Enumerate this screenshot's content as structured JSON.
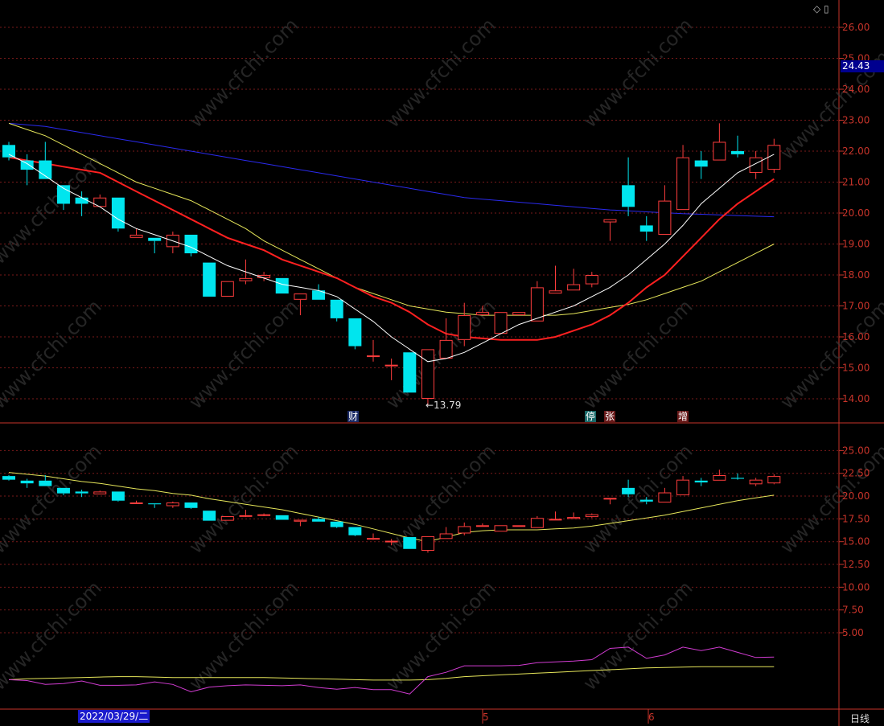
{
  "watermark": "www.cfchi.com",
  "colors": {
    "up": "#ff3d3d",
    "down": "#00e5ee",
    "ma5": "#ffffff",
    "ma10": "#ff2020",
    "ma20": "#e6e65a",
    "ma60": "#2a2aee",
    "osc": "#d23cd2",
    "axis": "#c8342a",
    "grid": "#7a1a1a"
  },
  "corner_icons": "◇ ▯",
  "current_price": "24.43",
  "low_label": "←13.79",
  "event_badges": [
    {
      "text": "财",
      "bg": "#1a2a66",
      "fg": "#ffffff"
    },
    {
      "text": "停",
      "bg": "#1a6a6a",
      "fg": "#ffffff"
    },
    {
      "text": "张",
      "bg": "#6a1a1a",
      "fg": "#ffffff"
    },
    {
      "text": "增",
      "bg": "#6a1a1a",
      "fg": "#ffffff"
    }
  ],
  "x_labels": {
    "date": "2022/03/29/二",
    "month5": "5",
    "month6": "6",
    "period": "日线"
  },
  "chart_data": [
    {
      "type": "candlestick",
      "panel": "main",
      "y_ticks": [
        "26.00",
        "25.00",
        "24.00",
        "23.00",
        "22.00",
        "21.00",
        "20.00",
        "19.00",
        "18.00",
        "17.00",
        "16.00",
        "15.00",
        "14.00"
      ],
      "ylim": [
        13.5,
        26.5
      ],
      "candles": [
        {
          "o": 22.2,
          "h": 22.3,
          "l": 21.7,
          "c": 21.8
        },
        {
          "o": 21.7,
          "h": 21.9,
          "l": 20.9,
          "c": 21.4
        },
        {
          "o": 21.7,
          "h": 22.3,
          "l": 21.1,
          "c": 21.1
        },
        {
          "o": 20.9,
          "h": 20.9,
          "l": 20.1,
          "c": 20.3
        },
        {
          "o": 20.5,
          "h": 20.7,
          "l": 19.9,
          "c": 20.3
        },
        {
          "o": 20.2,
          "h": 20.6,
          "l": 20.2,
          "c": 20.5
        },
        {
          "o": 20.5,
          "h": 20.5,
          "l": 19.4,
          "c": 19.5
        },
        {
          "o": 19.2,
          "h": 19.5,
          "l": 19.2,
          "c": 19.3
        },
        {
          "o": 19.2,
          "h": 19.2,
          "l": 18.7,
          "c": 19.1
        },
        {
          "o": 18.9,
          "h": 19.4,
          "l": 18.7,
          "c": 19.3
        },
        {
          "o": 19.3,
          "h": 19.3,
          "l": 18.6,
          "c": 18.7
        },
        {
          "o": 18.4,
          "h": 18.4,
          "l": 17.3,
          "c": 17.3
        },
        {
          "o": 17.3,
          "h": 17.8,
          "l": 17.3,
          "c": 17.8
        },
        {
          "o": 17.8,
          "h": 18.5,
          "l": 17.7,
          "c": 17.9
        },
        {
          "o": 17.9,
          "h": 18.1,
          "l": 17.8,
          "c": 18.0
        },
        {
          "o": 17.9,
          "h": 17.9,
          "l": 17.4,
          "c": 17.4
        },
        {
          "o": 17.2,
          "h": 17.4,
          "l": 16.7,
          "c": 17.4
        },
        {
          "o": 17.5,
          "h": 17.7,
          "l": 17.2,
          "c": 17.2
        },
        {
          "o": 17.2,
          "h": 17.2,
          "l": 16.5,
          "c": 16.6
        },
        {
          "o": 16.6,
          "h": 16.6,
          "l": 15.6,
          "c": 15.7
        },
        {
          "o": 15.4,
          "h": 15.9,
          "l": 15.2,
          "c": 15.4
        },
        {
          "o": 15.1,
          "h": 15.3,
          "l": 14.6,
          "c": 15.1
        },
        {
          "o": 15.5,
          "h": 15.5,
          "l": 14.2,
          "c": 14.2
        },
        {
          "o": 14.0,
          "h": 15.6,
          "l": 13.79,
          "c": 15.6
        },
        {
          "o": 15.3,
          "h": 16.6,
          "l": 15.3,
          "c": 15.9
        },
        {
          "o": 15.9,
          "h": 17.1,
          "l": 15.7,
          "c": 16.7
        },
        {
          "o": 16.7,
          "h": 17.0,
          "l": 16.7,
          "c": 16.8
        },
        {
          "o": 16.1,
          "h": 16.8,
          "l": 16.1,
          "c": 16.8
        },
        {
          "o": 16.7,
          "h": 16.8,
          "l": 16.7,
          "c": 16.8
        },
        {
          "o": 16.5,
          "h": 17.8,
          "l": 16.5,
          "c": 17.6
        },
        {
          "o": 17.4,
          "h": 18.3,
          "l": 17.4,
          "c": 17.5
        },
        {
          "o": 17.5,
          "h": 18.2,
          "l": 17.5,
          "c": 17.7
        },
        {
          "o": 17.7,
          "h": 18.1,
          "l": 17.6,
          "c": 18.0
        },
        {
          "o": 19.7,
          "h": 19.8,
          "l": 19.1,
          "c": 19.8
        },
        {
          "o": 20.9,
          "h": 21.8,
          "l": 19.9,
          "c": 20.2
        },
        {
          "o": 19.6,
          "h": 19.9,
          "l": 19.1,
          "c": 19.4
        },
        {
          "o": 19.3,
          "h": 20.9,
          "l": 19.3,
          "c": 20.4
        },
        {
          "o": 20.1,
          "h": 22.2,
          "l": 20.1,
          "c": 21.8
        },
        {
          "o": 21.7,
          "h": 22.0,
          "l": 21.1,
          "c": 21.5
        },
        {
          "o": 21.7,
          "h": 22.9,
          "l": 21.7,
          "c": 22.3
        },
        {
          "o": 22.0,
          "h": 22.5,
          "l": 21.8,
          "c": 21.9
        },
        {
          "o": 21.3,
          "h": 22.0,
          "l": 21.1,
          "c": 21.8
        },
        {
          "o": 21.4,
          "h": 22.4,
          "l": 21.3,
          "c": 22.2
        }
      ],
      "ma5": [
        21.9,
        21.6,
        21.2,
        20.8,
        20.5,
        20.2,
        19.8,
        19.5,
        19.3,
        19.1,
        18.9,
        18.6,
        18.3,
        18.1,
        17.9,
        17.7,
        17.6,
        17.5,
        17.3,
        16.9,
        16.5,
        16.0,
        15.6,
        15.2,
        15.3,
        15.5,
        15.8,
        16.1,
        16.4,
        16.6,
        16.8,
        17.0,
        17.3,
        17.6,
        18.0,
        18.5,
        19.0,
        19.6,
        20.3,
        20.8,
        21.3,
        21.6,
        21.9
      ],
      "ma10": [
        21.8,
        21.7,
        21.6,
        21.5,
        21.4,
        21.3,
        21.0,
        20.7,
        20.4,
        20.1,
        19.8,
        19.5,
        19.2,
        19.0,
        18.8,
        18.5,
        18.3,
        18.1,
        17.9,
        17.6,
        17.3,
        17.1,
        16.8,
        16.4,
        16.1,
        16.0,
        15.95,
        15.9,
        15.9,
        15.9,
        16.0,
        16.2,
        16.4,
        16.7,
        17.1,
        17.6,
        18.0,
        18.6,
        19.2,
        19.8,
        20.3,
        20.7,
        21.1
      ],
      "ma20": [
        22.9,
        22.7,
        22.5,
        22.2,
        21.9,
        21.6,
        21.3,
        21.0,
        20.8,
        20.6,
        20.4,
        20.1,
        19.8,
        19.5,
        19.1,
        18.8,
        18.5,
        18.2,
        17.9,
        17.6,
        17.4,
        17.2,
        17.0,
        16.9,
        16.8,
        16.75,
        16.7,
        16.7,
        16.7,
        16.7,
        16.7,
        16.75,
        16.85,
        16.95,
        17.05,
        17.2,
        17.4,
        17.6,
        17.8,
        18.1,
        18.4,
        18.7,
        19.0
      ],
      "ma60": [
        22.9,
        22.85,
        22.8,
        22.7,
        22.6,
        22.5,
        22.4,
        22.3,
        22.2,
        22.1,
        22.0,
        21.9,
        21.8,
        21.7,
        21.6,
        21.5,
        21.4,
        21.3,
        21.2,
        21.1,
        21.0,
        20.9,
        20.8,
        20.7,
        20.6,
        20.5,
        20.45,
        20.4,
        20.35,
        20.3,
        20.25,
        20.2,
        20.15,
        20.1,
        20.07,
        20.04,
        20.01,
        19.98,
        19.96,
        19.94,
        19.92,
        19.9,
        19.88
      ]
    },
    {
      "type": "candlestick",
      "panel": "sub",
      "y_ticks": [
        "25.00",
        "22.50",
        "20.00",
        "17.50",
        "15.00",
        "12.50",
        "10.00",
        "7.50",
        "5.00"
      ],
      "ylim": [
        2.5,
        27.5
      ],
      "ma_line": [
        22.6,
        22.4,
        22.2,
        21.9,
        21.6,
        21.4,
        21.1,
        20.8,
        20.6,
        20.3,
        20.1,
        19.7,
        19.4,
        19.1,
        18.8,
        18.5,
        18.1,
        17.7,
        17.3,
        16.9,
        16.4,
        15.9,
        15.4,
        15.0,
        15.5,
        16.0,
        16.2,
        16.3,
        16.3,
        16.3,
        16.4,
        16.5,
        16.7,
        17.0,
        17.3,
        17.6,
        17.9,
        18.3,
        18.7,
        19.1,
        19.5,
        19.8,
        20.1
      ]
    },
    {
      "type": "line",
      "panel": "oscillator",
      "osc_series": [
        0.3,
        0.1,
        -0.8,
        -0.6,
        0.0,
        -1.0,
        -1.0,
        -0.9,
        -0.2,
        -0.8,
        -2.5,
        -1.4,
        -1.1,
        -0.9,
        -1.0,
        -1.1,
        -0.9,
        -1.5,
        -1.9,
        -1.5,
        -2.0,
        -2.0,
        -3.0,
        1.0,
        2.0,
        3.5,
        3.5,
        3.5,
        3.6,
        4.2,
        4.4,
        4.6,
        4.9,
        7.5,
        7.8,
        5.2,
        6.0,
        7.8,
        7.0,
        7.8,
        6.6,
        5.4,
        5.5
      ],
      "signal_series": [
        0.3,
        0.5,
        0.6,
        0.7,
        0.8,
        0.9,
        1.0,
        1.0,
        0.9,
        0.8,
        0.8,
        0.8,
        0.8,
        0.8,
        0.8,
        0.7,
        0.6,
        0.5,
        0.4,
        0.3,
        0.2,
        0.2,
        0.2,
        0.3,
        0.6,
        1.0,
        1.2,
        1.4,
        1.6,
        1.8,
        2.0,
        2.2,
        2.4,
        2.6,
        2.8,
        3.0,
        3.1,
        3.2,
        3.3,
        3.3,
        3.3,
        3.3,
        3.3
      ]
    }
  ]
}
